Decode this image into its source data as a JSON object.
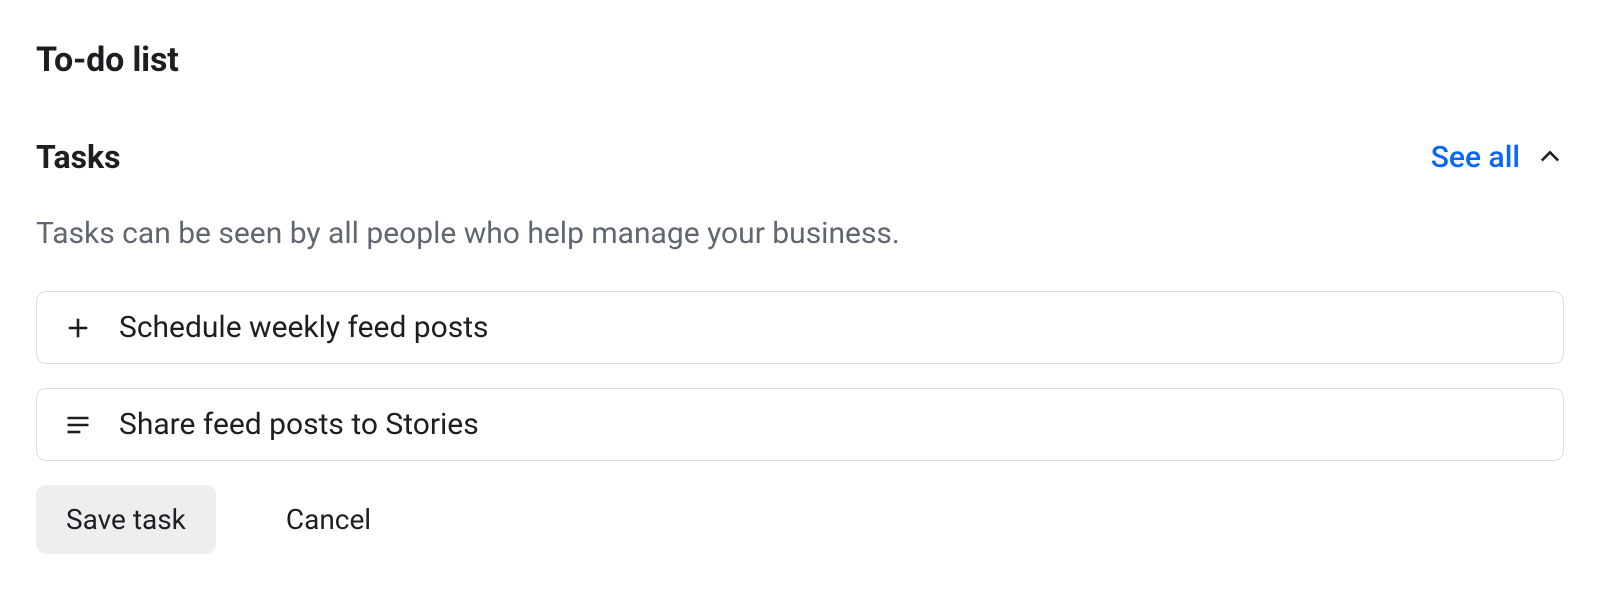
{
  "page_title": "To-do list",
  "tasks_section": {
    "title": "Tasks",
    "see_all_label": "See all",
    "helper_text": "Tasks can be seen by all people who help manage your business.",
    "title_input_value": "Schedule weekly feed posts",
    "details_input_value": "Share feed posts to Stories"
  },
  "buttons": {
    "save_label": "Save task",
    "cancel_label": "Cancel"
  }
}
